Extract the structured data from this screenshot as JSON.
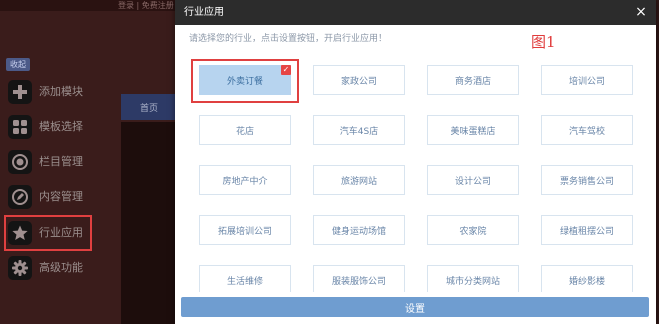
{
  "topbar": {
    "links": "登录 | 免费注册"
  },
  "sidebar": {
    "collapse_label": "收起",
    "items": [
      {
        "label": "添加模块",
        "icon": "plus-icon"
      },
      {
        "label": "模板选择",
        "icon": "grid-icon"
      },
      {
        "label": "栏目管理",
        "icon": "record-icon"
      },
      {
        "label": "内容管理",
        "icon": "edit-icon"
      },
      {
        "label": "行业应用",
        "icon": "star-icon"
      },
      {
        "label": "高级功能",
        "icon": "gear-icon"
      }
    ]
  },
  "background": {
    "nav_label": "首页"
  },
  "modal": {
    "title": "行业应用",
    "close_glyph": "×",
    "hint": "请选择您的行业，点击设置按钮，开启行业应用！",
    "figure_label": "图1",
    "industries": [
      "外卖订餐",
      "家政公司",
      "商务酒店",
      "培训公司",
      "花店",
      "汽车4S店",
      "美味蛋糕店",
      "汽车驾校",
      "房地产中介",
      "旅游网站",
      "设计公司",
      "票务销售公司",
      "拓展培训公司",
      "健身运动场馆",
      "农家院",
      "绿植租摆公司",
      "生活维修",
      "服装服饰公司",
      "城市分类网站",
      "婚纱影楼"
    ],
    "selected_index": 0,
    "check_glyph": "✓",
    "setup_label": "设置"
  },
  "colors": {
    "header_bg": "#2c2c2c",
    "selected_bg": "#b7d4ef",
    "item_border": "#d8e4ef",
    "item_text": "#6a86a8",
    "highlight_red": "#e04040",
    "button_bg": "#6f9dd0"
  }
}
